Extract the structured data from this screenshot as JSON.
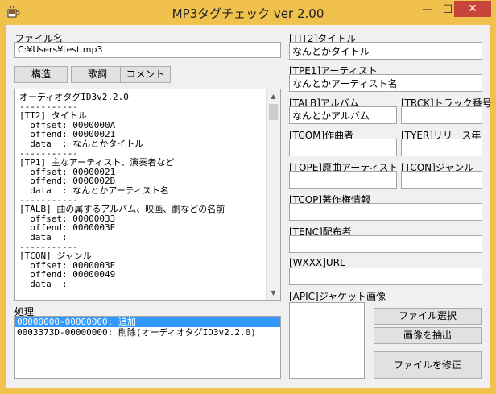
{
  "window": {
    "title": "MP3タグチェック ver 2.00"
  },
  "titlebar": {
    "minimize": "—",
    "maximize": "☐",
    "close": "✕"
  },
  "file": {
    "label": "ファイル名",
    "value": "C:¥Users¥test.mp3"
  },
  "tabs": {
    "structure": "構造",
    "lyrics": "歌詞",
    "comment": "コメント"
  },
  "structure_text": "オーディオタグID3v2.2.0\n-----------\n[TT2] タイトル\n  offset: 0000000A\n  offend: 00000021\n  data  : なんとかタイトル\n-----------\n[TP1] 主なアーティスト、演奏者など\n  offset: 00000021\n  offend: 0000002D\n  data  : なんとかアーティスト名\n-----------\n[TALB] 曲の属するアルバム、映画、劇などの名前\n  offset: 00000033\n  offend: 0000003E\n  data  :\n-----------\n[TCON] ジャンル\n  offset: 0000003E\n  offend: 00000049\n  data  :",
  "process": {
    "label": "処理",
    "items": [
      {
        "text": "00000000-00000000: 追加",
        "selected": true
      },
      {
        "text": "0003373D-00000000: 削除(オーディオタグID3v2.2.0)",
        "selected": false
      }
    ]
  },
  "tags": {
    "tit2": {
      "label": "[TIT2]タイトル",
      "value": "なんとかタイトル"
    },
    "tpe1": {
      "label": "[TPE1]アーティスト",
      "value": "なんとかアーティスト名"
    },
    "talb": {
      "label": "[TALB]アルバム",
      "value": "なんとかアルバム"
    },
    "trck": {
      "label": "[TRCK]トラック番号",
      "value": ""
    },
    "tcom": {
      "label": "[TCOM]作曲者",
      "value": ""
    },
    "tyer": {
      "label": "[TYER]リリース年",
      "value": ""
    },
    "tope": {
      "label": "[TOPE]原曲アーティスト",
      "value": ""
    },
    "tcon": {
      "label": "[TCON]ジャンル",
      "value": ""
    },
    "tcop": {
      "label": "[TCOP]著作権情報",
      "value": ""
    },
    "tenc": {
      "label": "[TENC]配布者",
      "value": ""
    },
    "wxxx": {
      "label": "[WXXX]URL",
      "value": ""
    },
    "apic": {
      "label": "[APIC]ジャケット画像"
    }
  },
  "buttons": {
    "select_file": "ファイル選択",
    "extract_image": "画像を抽出",
    "fix_file": "ファイルを修正"
  },
  "colors": {
    "titlebar": "#f0c24d",
    "close": "#c7443a",
    "selection": "#3399ff"
  }
}
